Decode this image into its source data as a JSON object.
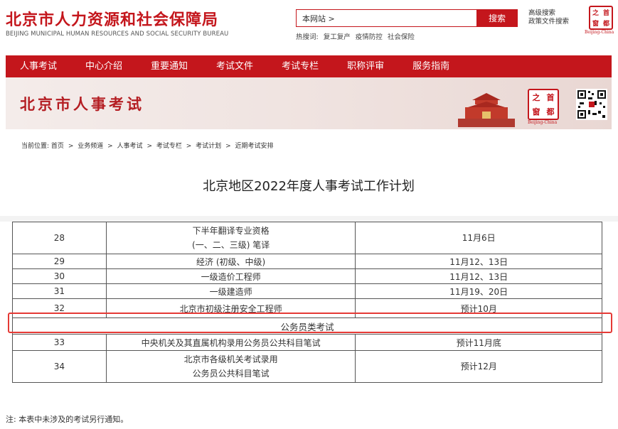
{
  "header": {
    "logo_cn": "北京市人力资源和社会保障局",
    "logo_en": "BEIJING MUNICIPAL HUMAN RESOURCES AND SOCIAL SECURITY BUREAU",
    "search_value": "本网站 >",
    "search_button": "搜索",
    "advanced_search": "高级搜索",
    "policy_search": "政策文件搜索",
    "hot_label": "热搜词:",
    "hot_words": [
      "复工复产",
      "疫情防控",
      "社会保险"
    ],
    "seal_chars": [
      "之",
      "首",
      "窗",
      "都"
    ],
    "seal_label": "Beijing-China"
  },
  "nav": {
    "items": [
      "人事考试",
      "中心介绍",
      "重要通知",
      "考试文件",
      "考试专栏",
      "职称评审",
      "服务指南"
    ]
  },
  "banner": {
    "title": "北京市人事考试",
    "seal_chars": [
      "之",
      "首",
      "窗",
      "都"
    ],
    "seal_label": "Beijing-China"
  },
  "breadcrumb": {
    "label": "当前位置:",
    "items": [
      "首页",
      "业务频道",
      "人事考试",
      "考试专栏",
      "考试计划",
      "近期考试安排"
    ],
    "separator": ">"
  },
  "page_title": "北京地区2022年度人事考试工作计划",
  "table": {
    "rows": [
      {
        "num": "28",
        "name_line1": "下半年翻译专业资格",
        "name_line2": "(一、二、三级) 笔译",
        "date": "11月6日"
      },
      {
        "num": "29",
        "name": "经济 (初级、中级)",
        "date": "11月12、13日"
      },
      {
        "num": "30",
        "name": "一级造价工程师",
        "date": "11月12、13日"
      },
      {
        "num": "31",
        "name": "一级建造师",
        "date": "11月19、20日"
      },
      {
        "num": "32",
        "name": "北京市初级注册安全工程师",
        "date": "预计10月"
      }
    ],
    "section": "公务员类考试",
    "rows2": [
      {
        "num": "33",
        "name": "中央机关及其直属机构录用公务员公共科目笔试",
        "date": "预计11月底"
      },
      {
        "num": "34",
        "name_line1": "北京市各级机关考试录用",
        "name_line2": "公务员公共科目笔试",
        "date": "预计12月"
      }
    ]
  },
  "note": "注: 本表中未涉及的考试另行通知。",
  "colors": {
    "brand_red": "#c4161c",
    "highlight": "#e53935"
  }
}
